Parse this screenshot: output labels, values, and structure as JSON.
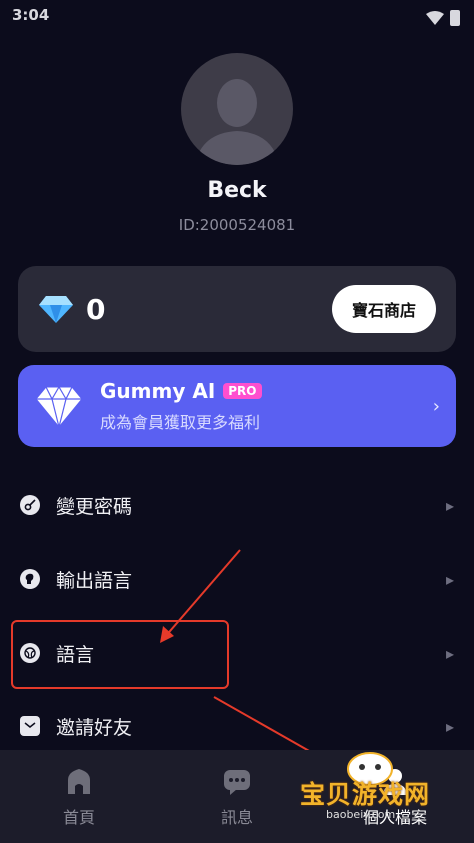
{
  "status_bar": {
    "time": "3:04"
  },
  "profile": {
    "name": "Beck",
    "id": "ID:2000524081"
  },
  "gems": {
    "count": "0",
    "shop_label": "寶石商店"
  },
  "pro": {
    "title": "Gummy AI",
    "badge": "PRO",
    "subtitle": "成為會員獲取更多福利"
  },
  "menu": [
    {
      "label": "變更密碼",
      "icon": "key-icon"
    },
    {
      "label": "輸出語言",
      "icon": "speaking-head-icon"
    },
    {
      "label": "語言",
      "icon": "globe-icon"
    },
    {
      "label": "邀請好友",
      "icon": "mail-icon"
    }
  ],
  "nav": [
    {
      "label": "首頁",
      "icon": "home-icon"
    },
    {
      "label": "訊息",
      "icon": "chat-icon"
    },
    {
      "label": "個人檔案",
      "icon": "profile-icon"
    }
  ],
  "watermark": {
    "text": "宝贝游戏网",
    "url": "baobeiy.com"
  },
  "colors": {
    "accent": "#5a60f2",
    "badge": "#ff4fcf",
    "annotation": "#e53a2a",
    "background": "#0c0c1c"
  }
}
